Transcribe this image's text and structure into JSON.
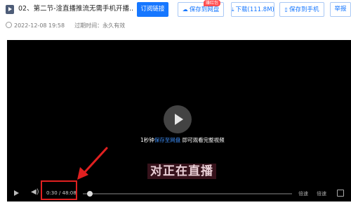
{
  "header": {
    "title": "02、第二节-淦直播推流无需手机开播...",
    "buttons": {
      "subscribe": "订阅链接",
      "save_cloud": "保存到网盘",
      "save_badge": "赚红包",
      "download": "下载(111.8M)",
      "save_phone": "保存到手机",
      "report": "举报"
    },
    "icons": [
      "video-file-icon",
      "cloud-save-icon",
      "download-icon",
      "phone-save-icon"
    ]
  },
  "meta": {
    "date": "2022-12-08 19:58",
    "expire": "过期时间：永久有效"
  },
  "player": {
    "notice_prefix": "1秒钟",
    "notice_link": "保存至网盘",
    "notice_suffix": " 即可观看完整视频",
    "watermark": "对正在直播",
    "time": "0:30 / 48:08",
    "speed": "倍速",
    "quality": "倍速"
  },
  "colors": {
    "accent": "#1677ff",
    "annotation": "#e02020",
    "badge": "#ff4d4f"
  }
}
